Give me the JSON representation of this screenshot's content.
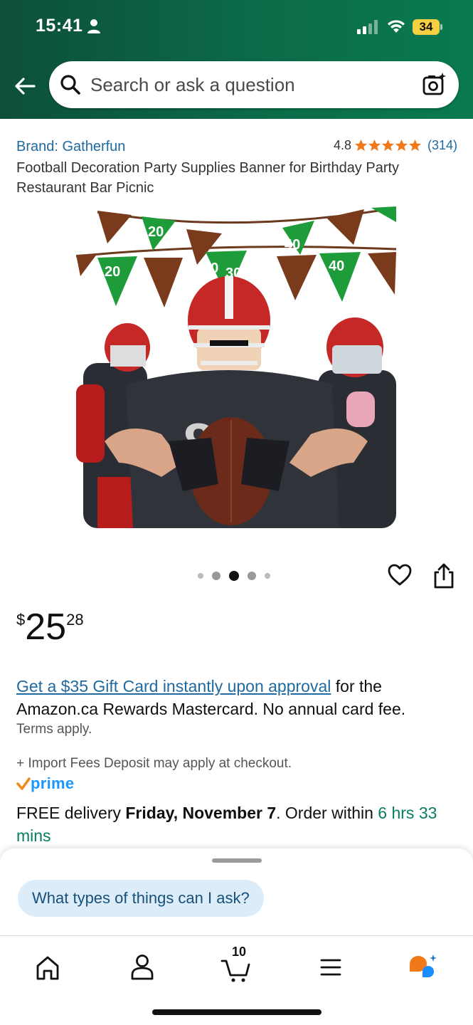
{
  "status_bar": {
    "time": "15:41",
    "battery": "34"
  },
  "search": {
    "placeholder": "Search or ask a question"
  },
  "product": {
    "brand": "Brand: Gatherfun",
    "rating_value": "4.8",
    "rating_stars": 4.8,
    "rating_count": "(314)",
    "title": "Football Decoration Party Supplies Banner for Birthday Party Restaurant Bar Picnic",
    "image_pennant_labels": [
      "20",
      "30",
      "30",
      "40",
      "40",
      "20"
    ],
    "price_symbol": "$",
    "price_whole": "25",
    "price_fraction": "28",
    "image_count": 5,
    "image_selected": 3
  },
  "promo": {
    "link": "Get a $35 Gift Card instantly upon approval",
    "text": " for the Amazon.ca Rewards Mastercard. No annual card fee.",
    "terms": "Terms apply."
  },
  "shipping": {
    "import_fees": "+ Import Fees Deposit may apply at checkout.",
    "prime_label": "prime",
    "delivery_prefix": "FREE delivery ",
    "delivery_date": "Friday, November 7",
    "delivery_mid": ". Order within ",
    "delivery_time": "6 hrs 33 mins"
  },
  "assistant": {
    "chip": "What types of things can I ask?"
  },
  "nav": {
    "cart_count": "10",
    "items": [
      "home-icon",
      "account-icon",
      "cart-icon",
      "menu-icon",
      "rufus-icon"
    ]
  },
  "colors": {
    "header_green": "#0b6b48",
    "link_blue": "#1f6aa0",
    "star_orange": "#f0791c",
    "prime_blue": "#1a98ff",
    "delivery_green": "#067d62",
    "chip_bg": "#dcedf9"
  }
}
